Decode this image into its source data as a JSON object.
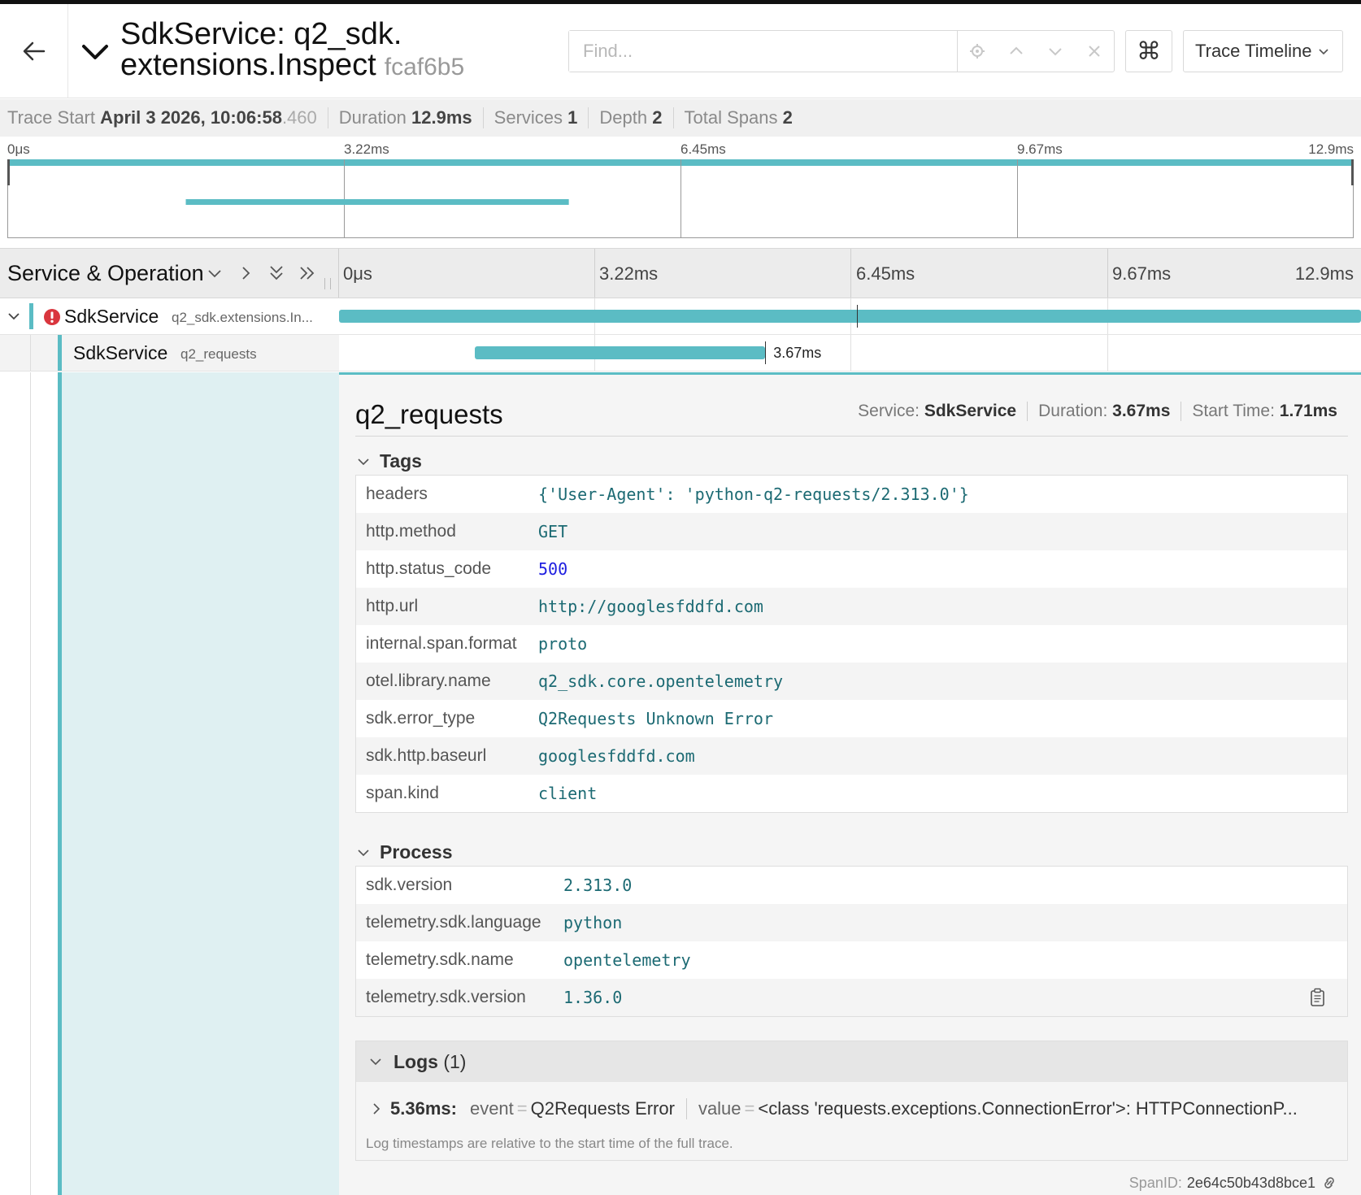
{
  "header": {
    "title": "SdkService: q2_sdk. extensions.Inspect",
    "trace_id": "fcaf6b5",
    "find_placeholder": "Find...",
    "keyboard_glyph": "⌘",
    "view_select": "Trace Timeline"
  },
  "summary": {
    "trace_start_label": "Trace Start",
    "trace_start_value": "April 3 2026, 10:06:58",
    "trace_start_ms": ".460",
    "duration_label": "Duration",
    "duration_value": "12.9ms",
    "services_label": "Services",
    "services_value": "1",
    "depth_label": "Depth",
    "depth_value": "2",
    "total_spans_label": "Total Spans",
    "total_spans_value": "2"
  },
  "timeline": {
    "ticks": [
      "0μs",
      "3.22ms",
      "6.45ms",
      "9.67ms",
      "12.9ms"
    ],
    "column_title": "Service & Operation"
  },
  "spans": [
    {
      "service": "SdkService",
      "operation": "q2_sdk.extensions.In...",
      "has_error": true,
      "start_ms": 0,
      "duration_ms": 12.9
    },
    {
      "service": "SdkService",
      "operation": "q2_requests",
      "has_error": false,
      "start_ms": 1.71,
      "duration_ms": 3.67,
      "duration_label": "3.67ms"
    }
  ],
  "detail": {
    "operation": "q2_requests",
    "service_label": "Service:",
    "service_value": "SdkService",
    "duration_label": "Duration:",
    "duration_value": "3.67ms",
    "start_label": "Start Time:",
    "start_value": "1.71ms",
    "tags_title": "Tags",
    "tags": [
      {
        "key": "headers",
        "value": "{'User-Agent': 'python-q2-requests/2.313.0'}"
      },
      {
        "key": "http.method",
        "value": "GET"
      },
      {
        "key": "http.status_code",
        "value": "500"
      },
      {
        "key": "http.url",
        "value": "http://googlesfddfd.com"
      },
      {
        "key": "internal.span.format",
        "value": "proto"
      },
      {
        "key": "otel.library.name",
        "value": "q2_sdk.core.opentelemetry"
      },
      {
        "key": "sdk.error_type",
        "value": "Q2Requests Unknown Error"
      },
      {
        "key": "sdk.http.baseurl",
        "value": "googlesfddfd.com"
      },
      {
        "key": "span.kind",
        "value": "client"
      }
    ],
    "process_title": "Process",
    "process": [
      {
        "key": "sdk.version",
        "value": "2.313.0"
      },
      {
        "key": "telemetry.sdk.language",
        "value": "python"
      },
      {
        "key": "telemetry.sdk.name",
        "value": "opentelemetry"
      },
      {
        "key": "telemetry.sdk.version",
        "value": "1.36.0"
      }
    ],
    "logs_title": "Logs",
    "logs_count": "(1)",
    "log": {
      "time": "5.36ms:",
      "k1": "event",
      "v1": "Q2Requests Error",
      "k2": "value",
      "v2": "<class 'requests.exceptions.ConnectionError'>: HTTPConnectionP..."
    },
    "logs_note": "Log timestamps are relative to the start time of the full trace.",
    "span_id_label": "SpanID:",
    "span_id_value": "2e64c50b43d8bce1"
  },
  "colors": {
    "accent": "#5bbcc4",
    "error": "#d9363e",
    "detail_left_bg": "#dff0f2"
  }
}
